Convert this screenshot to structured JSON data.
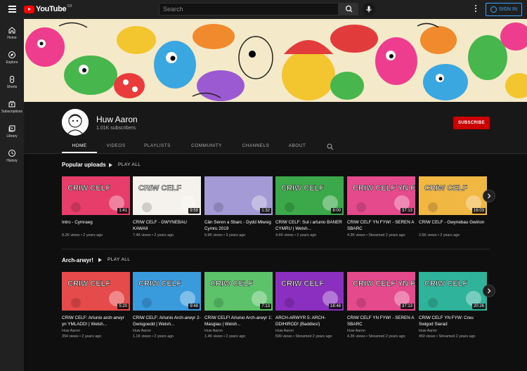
{
  "topbar": {
    "logo_text": "YouTube",
    "logo_region": "GB",
    "search_placeholder": "Search",
    "signin_label": "SIGN IN",
    "icons": [
      "menu-icon",
      "search-icon",
      "mic-icon",
      "more-vert-icon",
      "account-icon"
    ]
  },
  "sidebar": {
    "items": [
      {
        "label": "Home",
        "icon": "home-icon"
      },
      {
        "label": "Explore",
        "icon": "compass-icon"
      },
      {
        "label": "Shorts",
        "icon": "shorts-icon"
      },
      {
        "label": "Subscriptions",
        "icon": "subscriptions-icon"
      },
      {
        "label": "Library",
        "icon": "library-icon"
      },
      {
        "label": "History",
        "icon": "history-icon"
      }
    ]
  },
  "channel": {
    "name": "Huw Aaron",
    "subscribers": "1.01K subscribers",
    "subscribe_label": "SUBSCRIBE"
  },
  "tabs": [
    "HOME",
    "VIDEOS",
    "PLAYLISTS",
    "COMMUNITY",
    "CHANNELS",
    "ABOUT"
  ],
  "active_tab": "HOME",
  "shelves": [
    {
      "title": "Popular uploads",
      "play_all": "PLAY ALL",
      "videos": [
        {
          "title": "Intro - Cymraeg",
          "channel": "",
          "meta": "8.2K views • 2 years ago",
          "duration": "1:41",
          "thumb_text": "CRIW CELF",
          "bg": "#e63d6a"
        },
        {
          "title": "CRIW CELF - GWYNEBAU KAWAII",
          "channel": "",
          "meta": "7.4K views • 2 years ago",
          "duration": "9:59",
          "thumb_text": "CRIW CELF",
          "bg": "#f5f1ec"
        },
        {
          "title": "Cân Seren a Sbarc - Dydd Miwsig Cymru 2019",
          "channel": "",
          "meta": "5.9K views • 3 years ago",
          "duration": "1:32",
          "thumb_text": "",
          "bg": "#a39ad6"
        },
        {
          "title": "CRIW CELF: Sut i arlunio BANER CYMRU | Welsh...",
          "channel": "",
          "meta": "4.6K views • 2 years ago",
          "duration": "8:00",
          "thumb_text": "CRIW CELF",
          "bg": "#3ba84a"
        },
        {
          "title": "CRIW CELF YN FYW! - SEREN A SBARC",
          "channel": "",
          "meta": "4.3K views • Streamed 2 years ago",
          "duration": "37:13",
          "thumb_text": "CRIW CELF YN FYW!",
          "bg": "#e54a8c"
        },
        {
          "title": "CRIW CELF - Gwynebau Gwirion",
          "channel": "",
          "meta": "2.6K views • 2 years ago",
          "duration": "16:03",
          "thumb_text": "CRIW CELF",
          "bg": "#f0b742"
        }
      ]
    },
    {
      "title": "Arch-arwyr!",
      "play_all": "PLAY ALL",
      "videos": [
        {
          "title": "CRIW CELF: Arlunio arch-arwyr yn YMLADD! | Welsh...",
          "channel": "Huw Aaron",
          "meta": "354 views • 2 years ago",
          "duration": "5:20",
          "thumb_text": "CRIW CELF",
          "bg": "#e64b4b"
        },
        {
          "title": "CRIW CELF: Arlunio Arch-arwyr 2- Gwisgoedd | Welsh...",
          "channel": "Huw Aaron",
          "meta": "1.1K views • 2 years ago",
          "duration": "9:48",
          "thumb_text": "CRIW CELF",
          "bg": "#3a9bdc"
        },
        {
          "title": "CRIW CELF! Arlunio Arch-arwyr 1: Masgiau | Welsh...",
          "channel": "Huw Aaron",
          "meta": "1.4K views • 2 years ago",
          "duration": "7:13",
          "thumb_text": "CRIW CELF",
          "bg": "#5cc36b"
        },
        {
          "title": "ARCH-ARWYR 5: ARCH-DDIHIROD! (Baddies!)",
          "channel": "Huw Aaron",
          "meta": "599 views • Streamed 2 years ago",
          "duration": "18:48",
          "thumb_text": "CRIW CELF",
          "bg": "#8b2fc0"
        },
        {
          "title": "CRIW CELF YN FYW! - SEREN A SBARC",
          "channel": "Huw Aaron",
          "meta": "4.3K views • Streamed 2 years ago",
          "duration": "37:13",
          "thumb_text": "CRIW CELF YN FYW!",
          "bg": "#e54a8c"
        },
        {
          "title": "CRIW CELF YN FYW: Creu Swigod Siarad",
          "channel": "Huw Aaron",
          "meta": "450 views • Streamed 2 years ago",
          "duration": "20:26",
          "thumb_text": "CRIW CELF",
          "bg": "#2fb39a"
        }
      ]
    }
  ]
}
